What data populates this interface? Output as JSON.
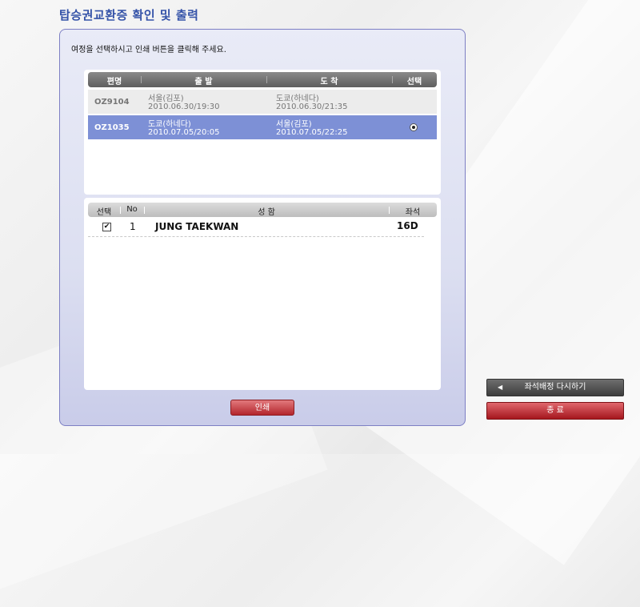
{
  "title": "탑승권교환증 확인 및 출력",
  "instruction": "여정을 선택하시고 인쇄 버튼을 클릭해 주세요.",
  "flights": {
    "headers": {
      "flight": "편명",
      "departure": "출 발",
      "arrival": "도 착",
      "select": "선택"
    },
    "rows": [
      {
        "flight": "OZ9104",
        "dep_place": "서울(김포)",
        "dep_time": "2010.06.30/19:30",
        "arr_place": "도쿄(하네다)",
        "arr_time": "2010.06.30/21:35",
        "selected": false
      },
      {
        "flight": "OZ1035",
        "dep_place": "도쿄(하네다)",
        "dep_time": "2010.07.05/20:05",
        "arr_place": "서울(김포)",
        "arr_time": "2010.07.05/22:25",
        "selected": true
      }
    ]
  },
  "passengers": {
    "headers": {
      "select": "선택",
      "no": "No",
      "name": "성 함",
      "seat": "좌석"
    },
    "rows": [
      {
        "checked": true,
        "check_glyph": "✔",
        "no": "1",
        "name": "JUNG TAEKWAN",
        "seat": "16D"
      }
    ]
  },
  "buttons": {
    "print": "인쇄",
    "reseat": "좌석배정 다시하기",
    "reseat_arrow": "◀",
    "exit": "종 료"
  },
  "colors": {
    "title": "#3452a8",
    "selected_row": "#7d90d6",
    "accent_red": "#b3262c"
  }
}
